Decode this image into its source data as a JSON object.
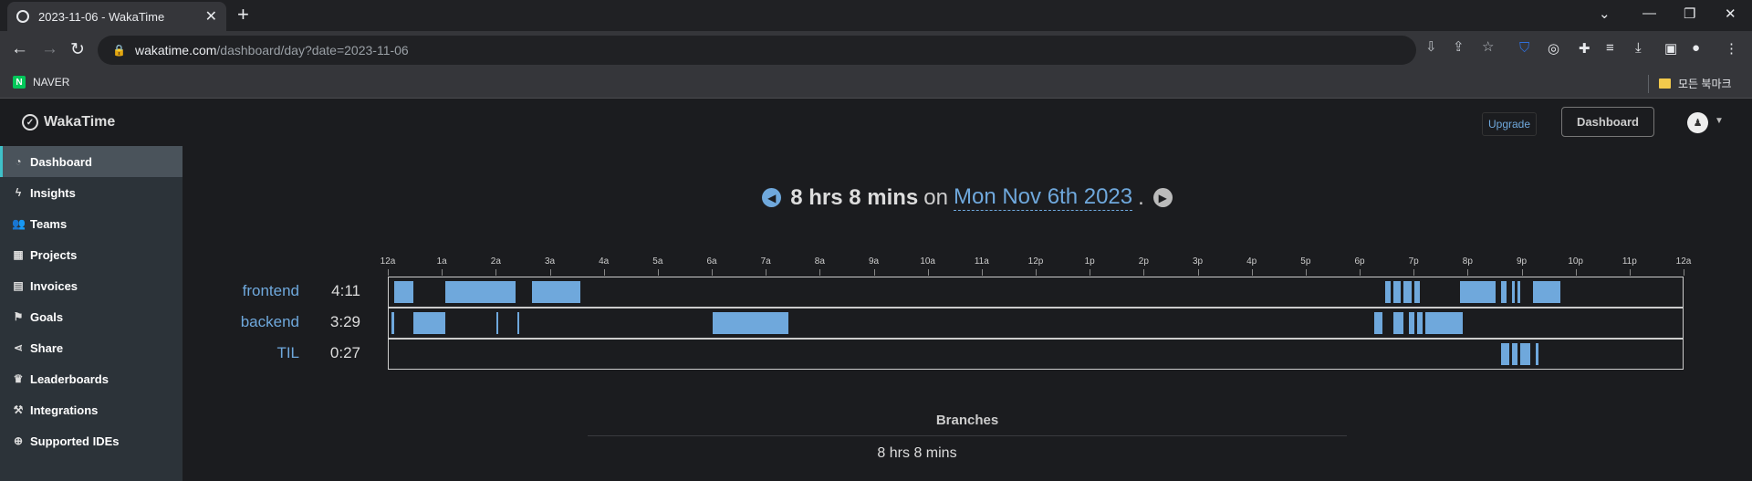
{
  "browser": {
    "tab_title": "2023-11-06 - WakaTime",
    "url_host": "wakatime.com",
    "url_path": "/dashboard/day?date=2023-11-06",
    "bookmarks": [
      "NAVER"
    ],
    "all_bookmarks": "모든 북마크"
  },
  "header": {
    "logo_text": "WakaTime",
    "upgrade_label": "Upgrade",
    "dashboard_label": "Dashboard"
  },
  "sidebar": {
    "items": [
      {
        "label": "Dashboard",
        "icon": "dashboard-icon",
        "active": true
      },
      {
        "label": "Insights",
        "icon": "bolt-icon"
      },
      {
        "label": "Teams",
        "icon": "users-icon"
      },
      {
        "label": "Projects",
        "icon": "grid-icon"
      },
      {
        "label": "Invoices",
        "icon": "file-icon"
      },
      {
        "label": "Goals",
        "icon": "flag-icon"
      },
      {
        "label": "Share",
        "icon": "share-icon"
      },
      {
        "label": "Leaderboards",
        "icon": "trophy-icon"
      },
      {
        "label": "Integrations",
        "icon": "wrench-icon"
      },
      {
        "label": "Supported IDEs",
        "icon": "plus-circle-icon"
      }
    ]
  },
  "day": {
    "total": "8 hrs 8 mins",
    "on": "on",
    "date": "Mon Nov 6th 2023",
    "period": "."
  },
  "chart_data": {
    "type": "timeline",
    "ticks": [
      "12a",
      "1a",
      "2a",
      "3a",
      "4a",
      "5a",
      "6a",
      "7a",
      "8a",
      "9a",
      "10a",
      "11a",
      "12p",
      "1p",
      "2p",
      "3p",
      "4p",
      "5p",
      "6p",
      "7p",
      "8p",
      "9p",
      "10p",
      "11p",
      "12a"
    ],
    "x_range_hours": [
      0,
      24
    ],
    "projects": [
      {
        "name": "frontend",
        "time": "4:11",
        "segments": [
          [
            0.1,
            0.45
          ],
          [
            1.05,
            2.0
          ],
          [
            2.0,
            2.35
          ],
          [
            2.65,
            3.55
          ],
          [
            18.45,
            18.55
          ],
          [
            18.6,
            18.75
          ],
          [
            18.8,
            18.95
          ],
          [
            19.0,
            19.1
          ],
          [
            19.85,
            20.5
          ],
          [
            20.6,
            20.7
          ],
          [
            20.8,
            20.85
          ],
          [
            20.9,
            20.95
          ],
          [
            21.2,
            21.7
          ]
        ]
      },
      {
        "name": "backend",
        "time": "3:29",
        "segments": [
          [
            0.05,
            0.1
          ],
          [
            0.45,
            1.05
          ],
          [
            2.0,
            2.03
          ],
          [
            2.38,
            2.42
          ],
          [
            6.0,
            7.4
          ],
          [
            18.25,
            18.4
          ],
          [
            18.6,
            18.8
          ],
          [
            18.9,
            19.0
          ],
          [
            19.05,
            19.15
          ],
          [
            19.2,
            19.9
          ]
        ]
      },
      {
        "name": "TIL",
        "time": "0:27",
        "segments": [
          [
            20.6,
            20.75
          ],
          [
            20.8,
            20.9
          ],
          [
            20.95,
            21.15
          ],
          [
            21.25,
            21.3
          ]
        ]
      }
    ],
    "color": "#6fa8dc"
  },
  "branches": {
    "title": "Branches",
    "value": "8 hrs 8 mins"
  }
}
